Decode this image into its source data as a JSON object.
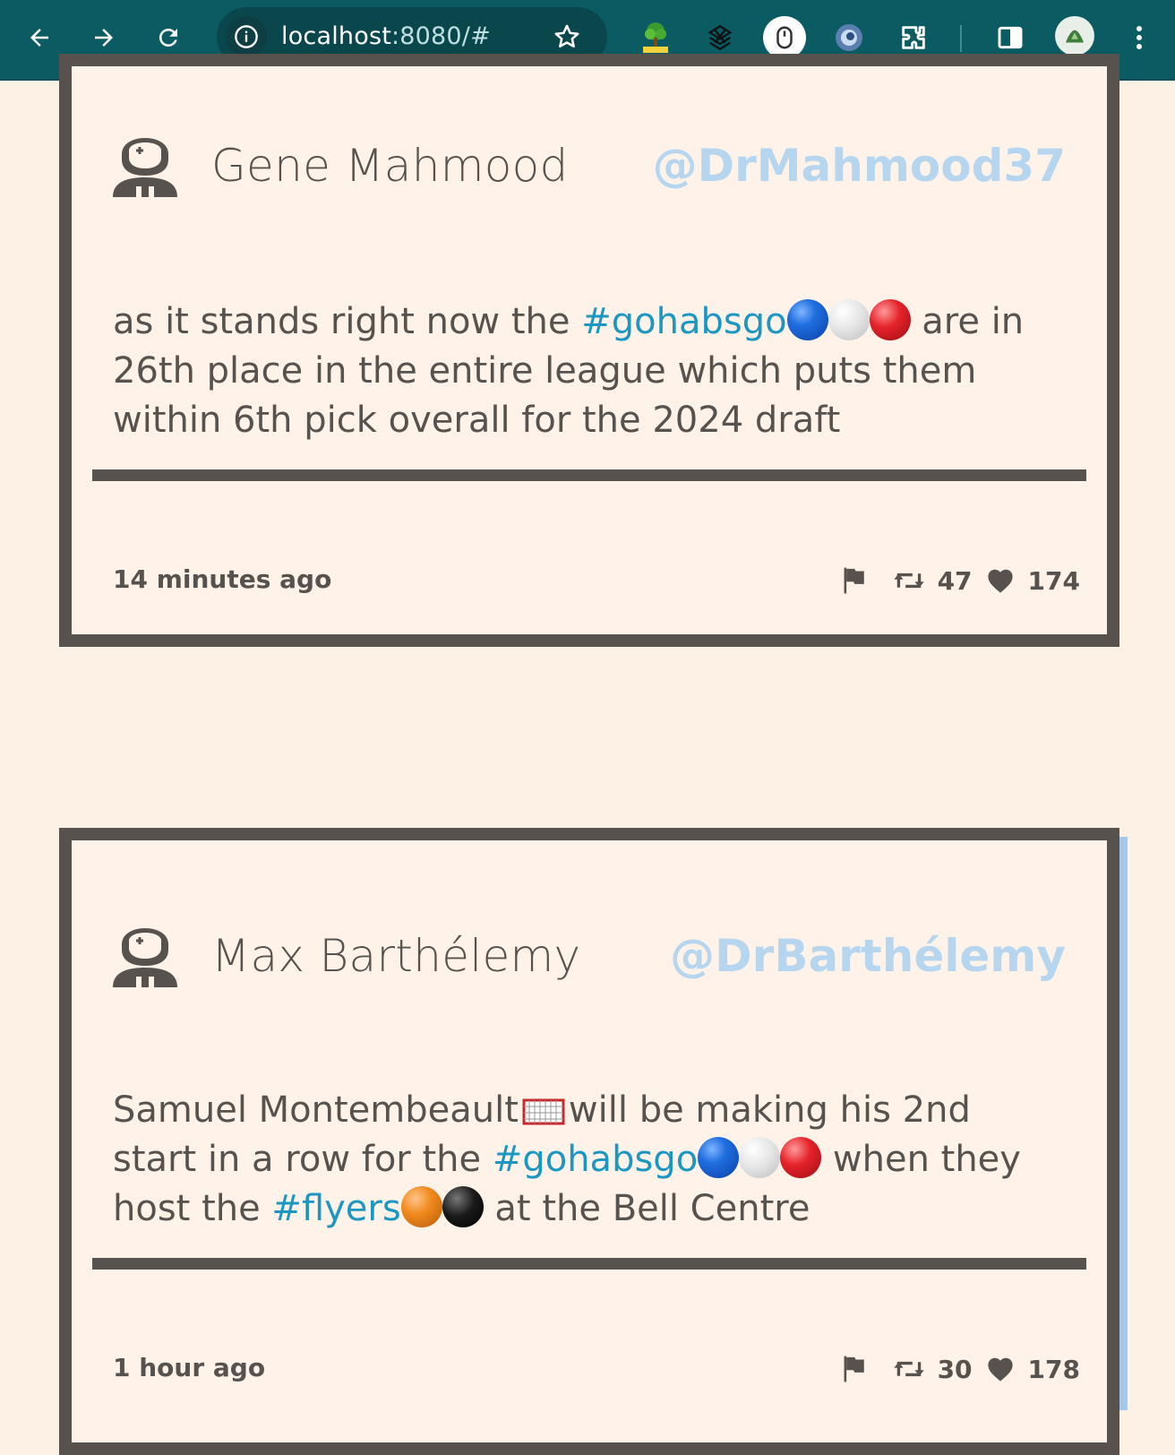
{
  "browser": {
    "url_host": "localhost",
    "url_rest": ":8080/#",
    "extensions": [
      "html-tree-extension-icon",
      "blender-extension-icon",
      "mouse-extension-icon",
      "circle-extension-icon",
      "puzzle-extensions-icon",
      "side-panel-icon",
      "profile-avatar",
      "more-menu-icon"
    ]
  },
  "posts": [
    {
      "author_name": "Gene Mahmood",
      "handle": "@DrMahmood37",
      "text_pre": "as it stands right now the ",
      "hashtag1": "#gohabsgo",
      "text_post": " are in 26th place in the entire league which puts them within 6th pick overall for the 2024 draft",
      "time": "14 minutes ago",
      "retweets": "47",
      "likes": "174"
    },
    {
      "author_name": "Max Barthélemy",
      "handle": "@DrBarthélemy",
      "text_pre": "Samuel Montembeault",
      "text_mid1": "will be making his 2nd start in a row for the ",
      "hashtag1": "#gohabsgo",
      "text_mid2": " when they host the ",
      "hashtag2": "#flyers",
      "text_post": " at the Bell Centre",
      "time": "1 hour ago",
      "retweets": "30",
      "likes": "178"
    }
  ],
  "colors": {
    "toolbar": "#0b5b63",
    "page_bg": "#fdf1e6",
    "card_border": "#57524d",
    "handle": "#b6d6ef",
    "hashtag": "#1c97c1"
  }
}
